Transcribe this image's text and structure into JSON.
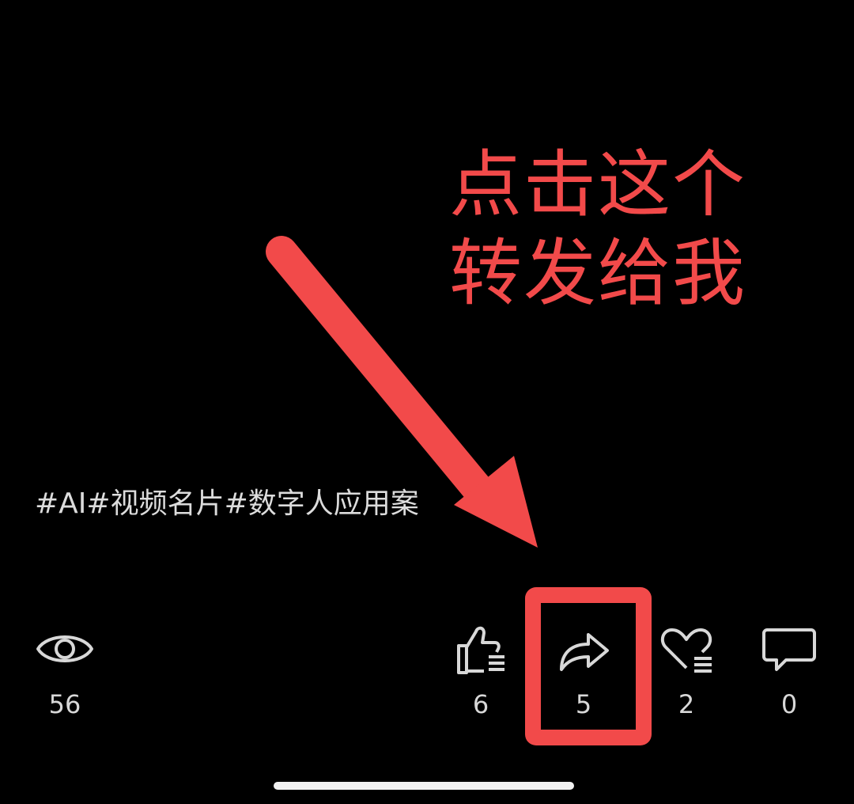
{
  "annotation": {
    "line1": "点击这个",
    "line2": "转发给我",
    "color": "#f24a4a"
  },
  "post": {
    "hashtags": "#AI#视频名片#数字人应用案"
  },
  "stats": {
    "views": {
      "icon": "eye-icon",
      "count": "56"
    },
    "likes": {
      "icon": "thumbs-up-icon",
      "count": "6"
    },
    "shares": {
      "icon": "share-forward-icon",
      "count": "5"
    },
    "favorites": {
      "icon": "heart-icon",
      "count": "2"
    },
    "comments": {
      "icon": "comment-bubble-icon",
      "count": "0"
    }
  },
  "colors": {
    "background": "#000000",
    "accent": "#f24a4a",
    "text": "#d8d8d8"
  }
}
